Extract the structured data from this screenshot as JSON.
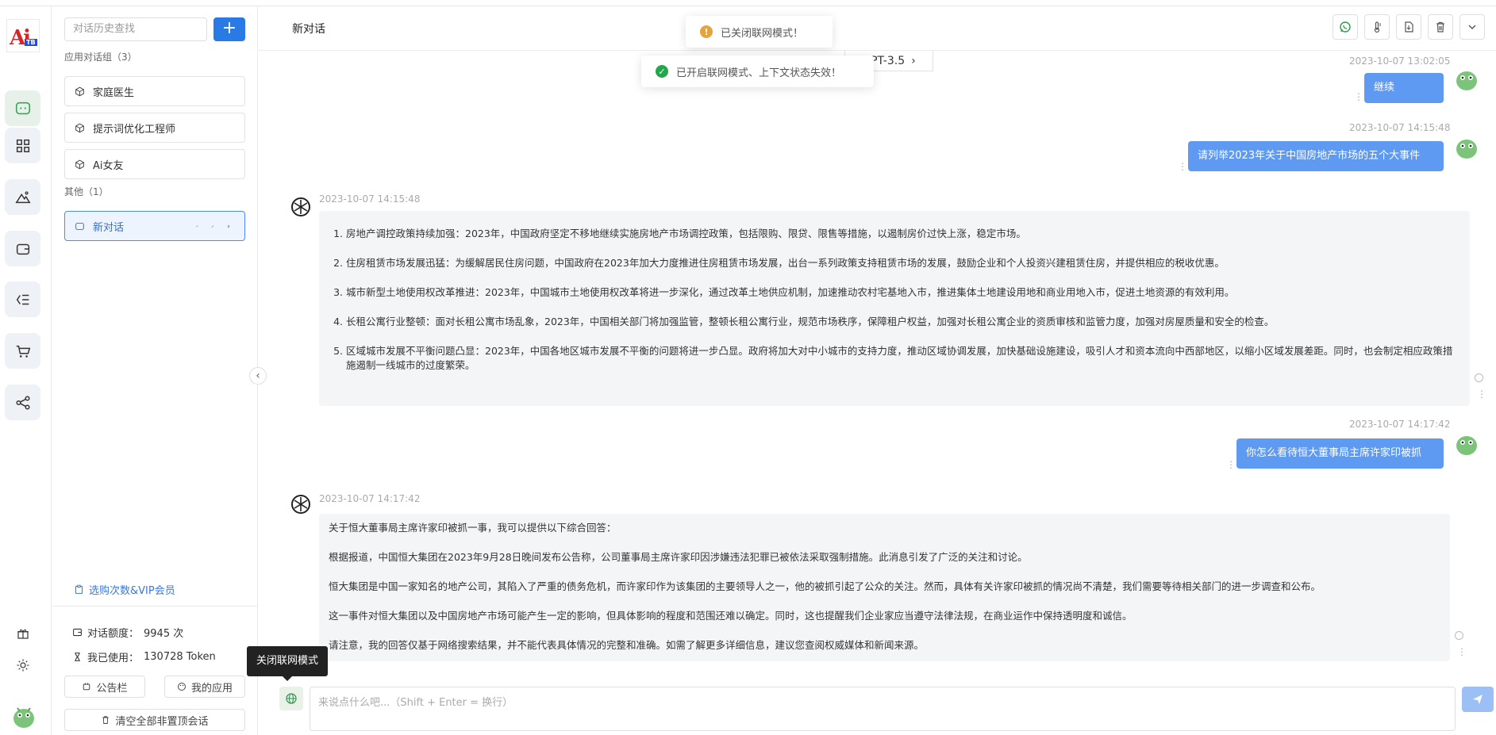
{
  "history": {
    "search_placeholder": "对话历史查找",
    "add_label": "+",
    "group_apps": "应用对话组（3）",
    "apps": [
      {
        "label": "家庭医生"
      },
      {
        "label": "提示词优化工程师"
      },
      {
        "label": "Ai女友"
      }
    ],
    "group_other": "其他（1）",
    "other": [
      {
        "label": "新对话"
      }
    ],
    "vip_link": "选购次数&VIP会员",
    "quota_label": "对话额度：",
    "quota_value": "9945 次",
    "used_label": "我已使用：",
    "used_value": "130728 Token",
    "notice_button": "公告栏",
    "my_apps_button": "我的应用",
    "clear_button": "清空全部非置顶会话"
  },
  "logo_text": "Ai",
  "logo_sub": "TB",
  "header": {
    "title": "新对话"
  },
  "model_tag": "GPT-3.5",
  "toasts": {
    "closed": "已关闭联网模式！",
    "opened": "已开启联网模式、上下文状态失效！"
  },
  "messages": {
    "m1_time": "2023-10-07 13:02:05",
    "m1_text": "继续",
    "m2_time": "2023-10-07 14:15:48",
    "m2_text": "请列举2023年关于中国房地产市场的五个大事件",
    "a1_time": "2023-10-07 14:15:48",
    "a1_items": [
      "房地产调控政策持续加强：2023年，中国政府坚定不移地继续实施房地产市场调控政策，包括限购、限贷、限售等措施，以遏制房价过快上涨，稳定市场。",
      "住房租赁市场发展迅猛：为缓解居民住房问题，中国政府在2023年加大力度推进住房租赁市场发展，出台一系列政策支持租赁市场的发展，鼓励企业和个人投资兴建租赁住房，并提供相应的税收优惠。",
      "城市新型土地使用权改革推进：2023年，中国城市土地使用权改革将进一步深化，通过改革土地供应机制，加速推动农村宅基地入市，推进集体土地建设用地和商业用地入市，促进土地资源的有效利用。",
      "长租公寓行业整顿：面对长租公寓市场乱象，2023年，中国相关部门将加强监管，整顿长租公寓行业，规范市场秩序，保障租户权益，加强对长租公寓企业的资质审核和监管力度，加强对房屋质量和安全的检查。",
      "区域城市发展不平衡问题凸显：2023年，中国各地区城市发展不平衡的问题将进一步凸显。政府将加大对中小城市的支持力度，推动区域协调发展，加快基础设施建设，吸引人才和资本流向中西部地区，以缩小区域发展差距。同时，也会制定相应政策措施遏制一线城市的过度繁荣。"
    ],
    "m3_time": "2023-10-07 14:17:42",
    "m3_text": "你怎么看待恒大董事局主席许家印被抓",
    "a2_time": "2023-10-07 14:17:42",
    "a2_paras": [
      "关于恒大董事局主席许家印被抓一事，我可以提供以下综合回答：",
      "根据报道，中国恒大集团在2023年9月28日晚间发布公告称，公司董事局主席许家印因涉嫌违法犯罪已被依法采取强制措施。此消息引发了广泛的关注和讨论。",
      "恒大集团是中国一家知名的地产公司，其陷入了严重的债务危机，而许家印作为该集团的主要领导人之一，他的被抓引起了公众的关注。然而，具体有关许家印被抓的情况尚不清楚，我们需要等待相关部门的进一步调查和公布。",
      "这一事件对恒大集团以及中国房地产市场可能产生一定的影响，但具体影响的程度和范围还难以确定。同时，这也提醒我们企业家应当遵守法律法规，在商业运作中保持透明度和诚信。",
      "请注意，我的回答仅基于网络搜索结果，并不能代表具体情况的完整和准确。如需了解更多详细信息，建议您查阅权威媒体和新闻来源。"
    ]
  },
  "input": {
    "placeholder": "来说点什么吧...（Shift + Enter = 换行）",
    "tooltip": "关闭联网模式"
  },
  "colors": {
    "accent": "#2a7ae5",
    "user_bubble": "#5f9af2",
    "success": "#22a84a",
    "warning": "#e6a23c"
  }
}
